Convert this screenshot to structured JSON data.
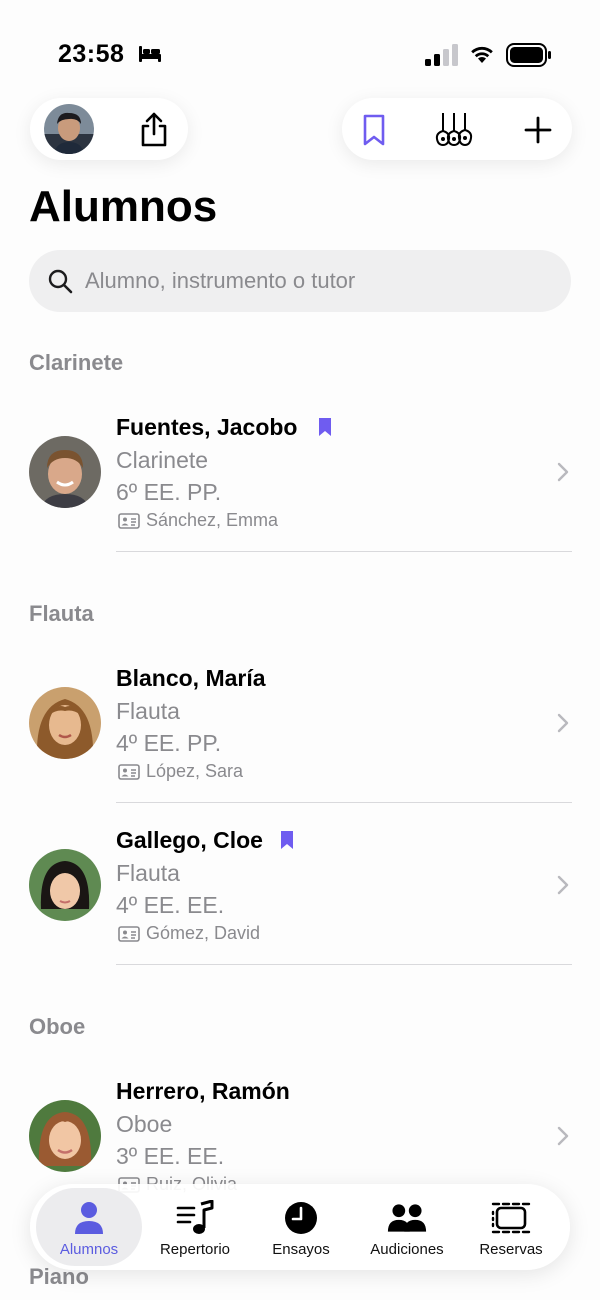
{
  "status_bar": {
    "time": "23:58",
    "icons": [
      "bed-icon",
      "cellular-signal-icon",
      "wifi-icon",
      "battery-icon"
    ]
  },
  "toolbar": {
    "left": [
      "profile-avatar",
      "share-icon"
    ],
    "right": [
      "bookmark-icon",
      "instruments-icon",
      "plus-icon"
    ]
  },
  "page": {
    "title": "Alumnos"
  },
  "search": {
    "placeholder": "Alumno, instrumento o tutor",
    "value": ""
  },
  "sections": [
    {
      "header": "Clarinete",
      "students": [
        {
          "name": "Fuentes, Jacobo",
          "bookmarked": true,
          "instrument": "Clarinete",
          "level": "6º EE. PP.",
          "tutor": "Sánchez, Emma"
        }
      ]
    },
    {
      "header": "Flauta",
      "students": [
        {
          "name": "Blanco, María",
          "bookmarked": false,
          "instrument": "Flauta",
          "level": "4º EE. PP.",
          "tutor": "López, Sara"
        },
        {
          "name": "Gallego, Cloe",
          "bookmarked": true,
          "instrument": "Flauta",
          "level": "4º EE. EE.",
          "tutor": "Gómez, David"
        }
      ]
    },
    {
      "header": "Oboe",
      "students": [
        {
          "name": "Herrero, Ramón",
          "bookmarked": false,
          "instrument": "Oboe",
          "level": "3º EE. EE.",
          "tutor": "Ruiz, Olivia"
        }
      ]
    },
    {
      "header": "Piano",
      "students": []
    }
  ],
  "tab_bar": {
    "tabs": [
      {
        "label": "Alumnos",
        "icon": "person-icon",
        "active": true
      },
      {
        "label": "Repertorio",
        "icon": "music-list-icon",
        "active": false
      },
      {
        "label": "Ensayos",
        "icon": "clock-icon",
        "active": false
      },
      {
        "label": "Audiciones",
        "icon": "people-icon",
        "active": false
      },
      {
        "label": "Reservas",
        "icon": "rooms-icon",
        "active": false
      }
    ]
  },
  "colors": {
    "accent": "#6f5cf0",
    "secondary_text": "#8a8a8e",
    "background": "#fdfdfd"
  }
}
